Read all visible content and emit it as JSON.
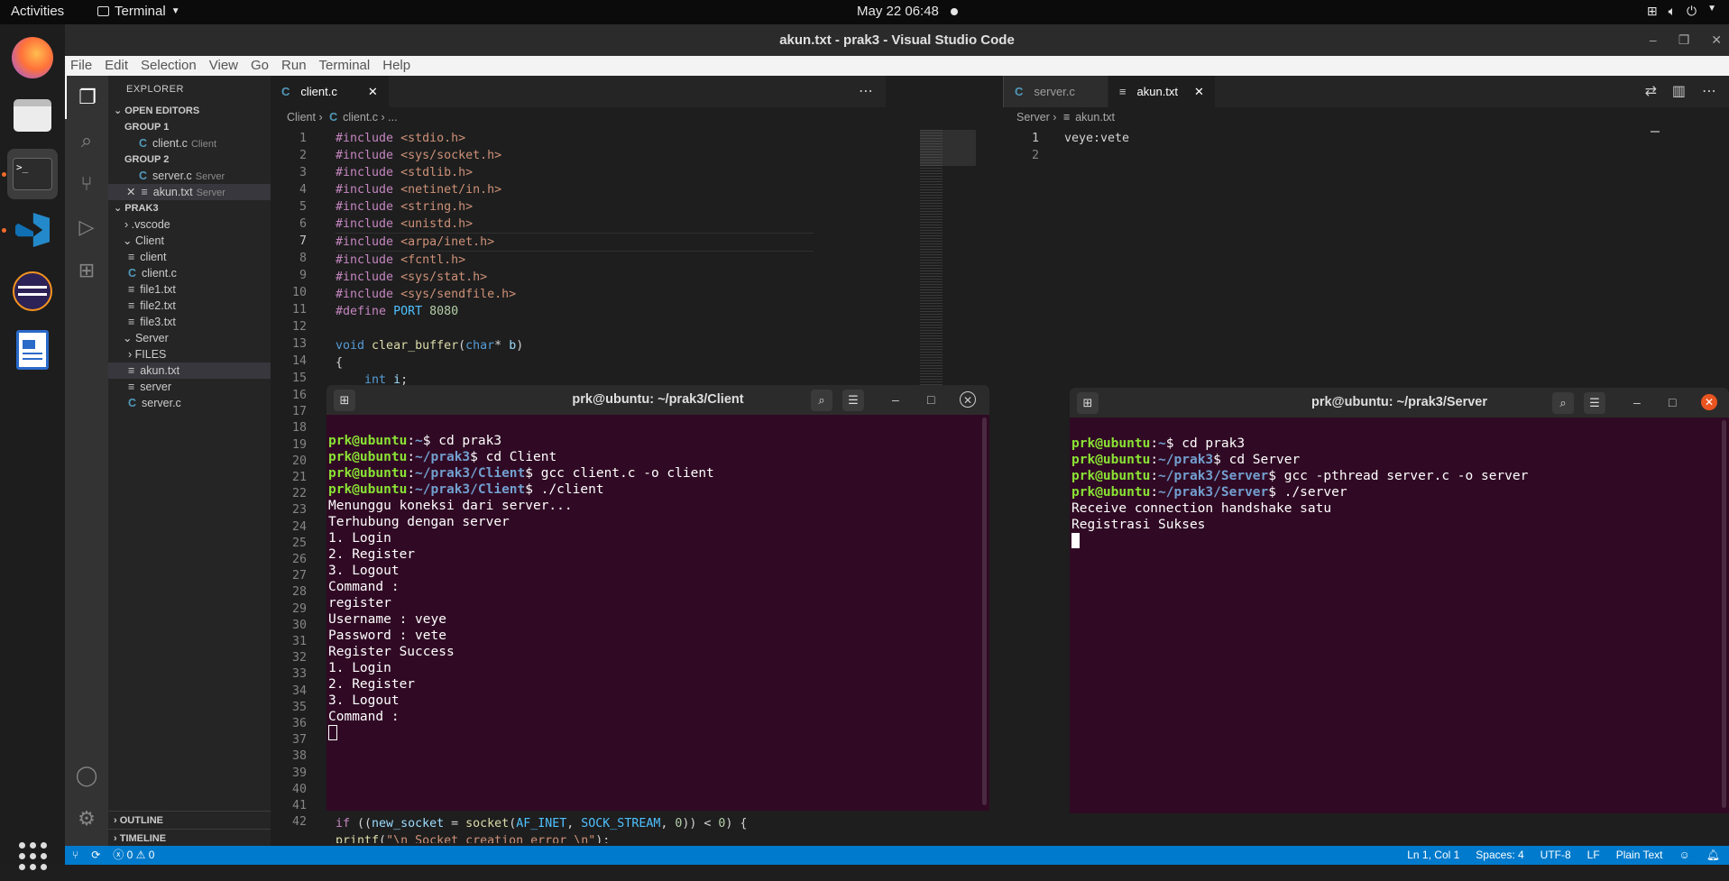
{
  "topbar": {
    "activities": "Activities",
    "app": "Terminal",
    "clock": "May 22  06:48"
  },
  "vscode": {
    "title": "akun.txt - prak3 - Visual Studio Code",
    "menu": [
      "File",
      "Edit",
      "Selection",
      "View",
      "Go",
      "Run",
      "Terminal",
      "Help"
    ]
  },
  "sidebar": {
    "title": "EXPLORER",
    "open_editors": "OPEN EDITORS",
    "group1": "GROUP 1",
    "group2": "GROUP 2",
    "open_items": [
      {
        "name": "client.c",
        "desc": "Client"
      },
      {
        "name": "server.c",
        "desc": "Server"
      },
      {
        "name": "akun.txt",
        "desc": "Server"
      }
    ],
    "project": "PRAK3",
    "tree": [
      ".vscode",
      "Client",
      "client",
      "client.c",
      "file1.txt",
      "file2.txt",
      "file3.txt",
      "Server",
      "FILES",
      "akun.txt",
      "server",
      "server.c"
    ],
    "outline": "OUTLINE",
    "timeline": "TIMELINE"
  },
  "editor_left": {
    "tab": "client.c",
    "breadcrumb_folder": "Client",
    "breadcrumb_file": "client.c",
    "breadcrumb_more": "...",
    "lines": [
      "#include <stdio.h>",
      "#include <sys/socket.h>",
      "#include <stdlib.h>",
      "#include <netinet/in.h>",
      "#include <string.h>",
      "#include <unistd.h>",
      "#include <arpa/inet.h>",
      "#include <fcntl.h>",
      "#include <sys/stat.h>",
      "#include <sys/sendfile.h>",
      "#define PORT 8080",
      "",
      "void clear_buffer(char* b)",
      "{",
      "    int i;"
    ],
    "line_numbers_top": [
      "1",
      "2",
      "3",
      "4",
      "5",
      "6",
      "7",
      "8",
      "9",
      "10",
      "11",
      "12",
      "13",
      "14",
      "15"
    ],
    "line_numbers_mid": [
      "16",
      "17",
      "18",
      "19",
      "20",
      "21",
      "22",
      "23",
      "24",
      "25",
      "26",
      "27",
      "28",
      "29",
      "30",
      "31",
      "32",
      "33",
      "34",
      "35",
      "36",
      "37",
      "38",
      "39",
      "40",
      "41",
      "42"
    ],
    "line_41": "    if ((new_socket = socket(AF_INET, SOCK_STREAM, 0)) < 0) {",
    "line_42": "        printf(\"\\n Socket creation error \\n\");"
  },
  "editor_right": {
    "tab_inactive": "server.c",
    "tab_active": "akun.txt",
    "breadcrumb_folder": "Server",
    "breadcrumb_file": "akun.txt",
    "line_numbers": [
      "1",
      "2"
    ],
    "lines": [
      "veye:vete",
      ""
    ]
  },
  "terminal_client": {
    "title": "prk@ubuntu: ~/prak3/Client",
    "lines": [
      {
        "user": "prk@ubuntu",
        "path": "~",
        "cmd": "$ cd prak3"
      },
      {
        "user": "prk@ubuntu",
        "path": "~/prak3",
        "cmd": "$ cd Client"
      },
      {
        "user": "prk@ubuntu",
        "path": "~/prak3/Client",
        "cmd": "$ gcc client.c -o client"
      },
      {
        "user": "prk@ubuntu",
        "path": "~/prak3/Client",
        "cmd": "$ ./client"
      }
    ],
    "output": [
      "Menunggu koneksi dari server...",
      "Terhubung dengan server",
      "1. Login",
      "2. Register",
      "3. Logout",
      "Command :",
      "register",
      "Username : veye",
      "Password : vete",
      "Register Success",
      "1. Login",
      "2. Register",
      "3. Logout",
      "Command :"
    ]
  },
  "terminal_server": {
    "title": "prk@ubuntu: ~/prak3/Server",
    "lines": [
      {
        "user": "prk@ubuntu",
        "path": "~",
        "cmd": "$ cd prak3"
      },
      {
        "user": "prk@ubuntu",
        "path": "~/prak3",
        "cmd": "$ cd Server"
      },
      {
        "user": "prk@ubuntu",
        "path": "~/prak3/Server",
        "cmd": "$ gcc -pthread server.c -o server"
      },
      {
        "user": "prk@ubuntu",
        "path": "~/prak3/Server",
        "cmd": "$ ./server"
      }
    ],
    "output": [
      "Receive connection handshake satu",
      "Registrasi Sukses"
    ]
  },
  "statusbar": {
    "problems": "ⓧ 0 ⚠ 0",
    "position": "Ln 1, Col 1",
    "spaces": "Spaces: 4",
    "encoding": "UTF-8",
    "eol": "LF",
    "language": "Plain Text"
  },
  "colors": {
    "statusbar": "#007acc",
    "terminal_bg": "#300a24",
    "prompt_user": "#8ae234",
    "prompt_path": "#729fcf"
  }
}
